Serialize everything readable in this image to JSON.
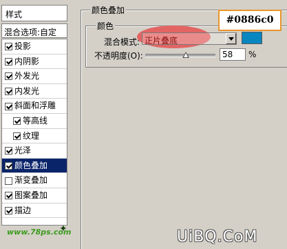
{
  "left_panel": {
    "header": "样式",
    "blend_options": "混合选项:自定",
    "items": [
      {
        "label": "投影",
        "checked": true,
        "sub": false,
        "selected": false
      },
      {
        "label": "内阴影",
        "checked": true,
        "sub": false,
        "selected": false
      },
      {
        "label": "外发光",
        "checked": true,
        "sub": false,
        "selected": false
      },
      {
        "label": "内发光",
        "checked": true,
        "sub": false,
        "selected": false
      },
      {
        "label": "斜面和浮雕",
        "checked": true,
        "sub": false,
        "selected": false
      },
      {
        "label": "等高线",
        "checked": true,
        "sub": true,
        "selected": false
      },
      {
        "label": "纹理",
        "checked": true,
        "sub": true,
        "selected": false
      },
      {
        "label": "光泽",
        "checked": true,
        "sub": false,
        "selected": false
      },
      {
        "label": "颜色叠加",
        "checked": true,
        "sub": false,
        "selected": true
      },
      {
        "label": "渐变叠加",
        "checked": false,
        "sub": false,
        "selected": false
      },
      {
        "label": "图案叠加",
        "checked": true,
        "sub": false,
        "selected": false
      },
      {
        "label": "描边",
        "checked": true,
        "sub": false,
        "selected": false
      }
    ],
    "logo_text": "www.78ps.com"
  },
  "panel": {
    "section_title": "颜色叠加",
    "color_group_title": "颜色",
    "blend_mode_label": "混合模式:",
    "blend_mode_value": "正片叠底",
    "color_hex": "#0886c0",
    "hex_callout": "#0886c0",
    "opacity_label": "不透明度(O):",
    "opacity_value": "58",
    "opacity_percent": 58,
    "percent_sign": "%"
  },
  "watermark": "UiBQ.CoM",
  "colors": {
    "selected_bg": "#0a246a",
    "swatch": "#0886c0",
    "callout_border": "#e8962a",
    "highlight": "#e83c3c"
  }
}
